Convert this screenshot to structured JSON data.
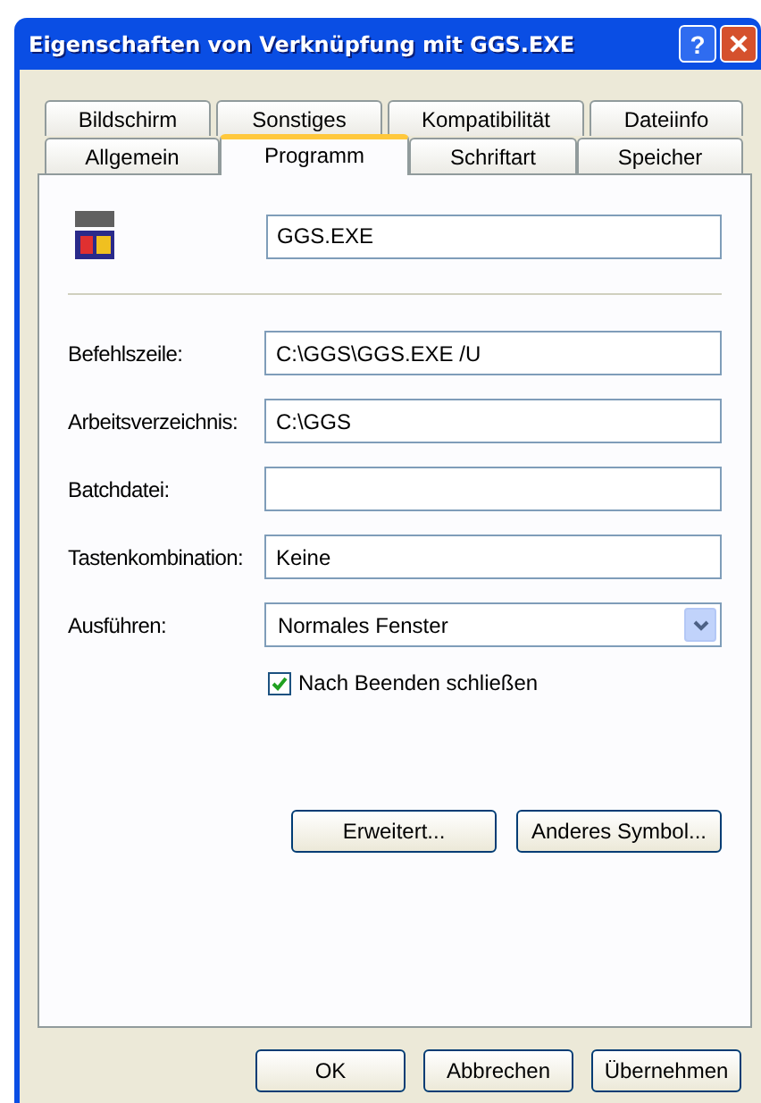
{
  "window": {
    "title": "Eigenschaften von Verknüpfung mit GGS.EXE",
    "help_button": "?"
  },
  "tab_rows": [
    [
      {
        "label": "Bildschirm",
        "selected": false
      },
      {
        "label": "Sonstiges",
        "selected": false
      },
      {
        "label": "Kompatibilität",
        "selected": false
      },
      {
        "label": "Dateiinfo",
        "selected": false
      }
    ],
    [
      {
        "label": "Allgemein",
        "selected": false
      },
      {
        "label": "Programm",
        "selected": true
      },
      {
        "label": "Schriftart",
        "selected": false
      },
      {
        "label": "Speicher",
        "selected": false
      }
    ]
  ],
  "program_name": "GGS.EXE",
  "fields": [
    {
      "label": "Befehlszeile:",
      "value": "C:\\GGS\\GGS.EXE /U"
    },
    {
      "label": "Arbeitsverzeichnis:",
      "value": "C:\\GGS"
    },
    {
      "label": "Batchdatei:"
    },
    {
      "label": "Tastenkombination:",
      "value": "Keine"
    }
  ],
  "run": {
    "label": "Ausführen:",
    "value": "Normales Fenster"
  },
  "close_on_exit": {
    "label": "Nach Beenden schließen",
    "checked": true
  },
  "panel_buttons": [
    "Erweitert...",
    "Anderes Symbol..."
  ],
  "dialog_buttons": [
    "OK",
    "Abbrechen",
    "Übernehmen"
  ]
}
